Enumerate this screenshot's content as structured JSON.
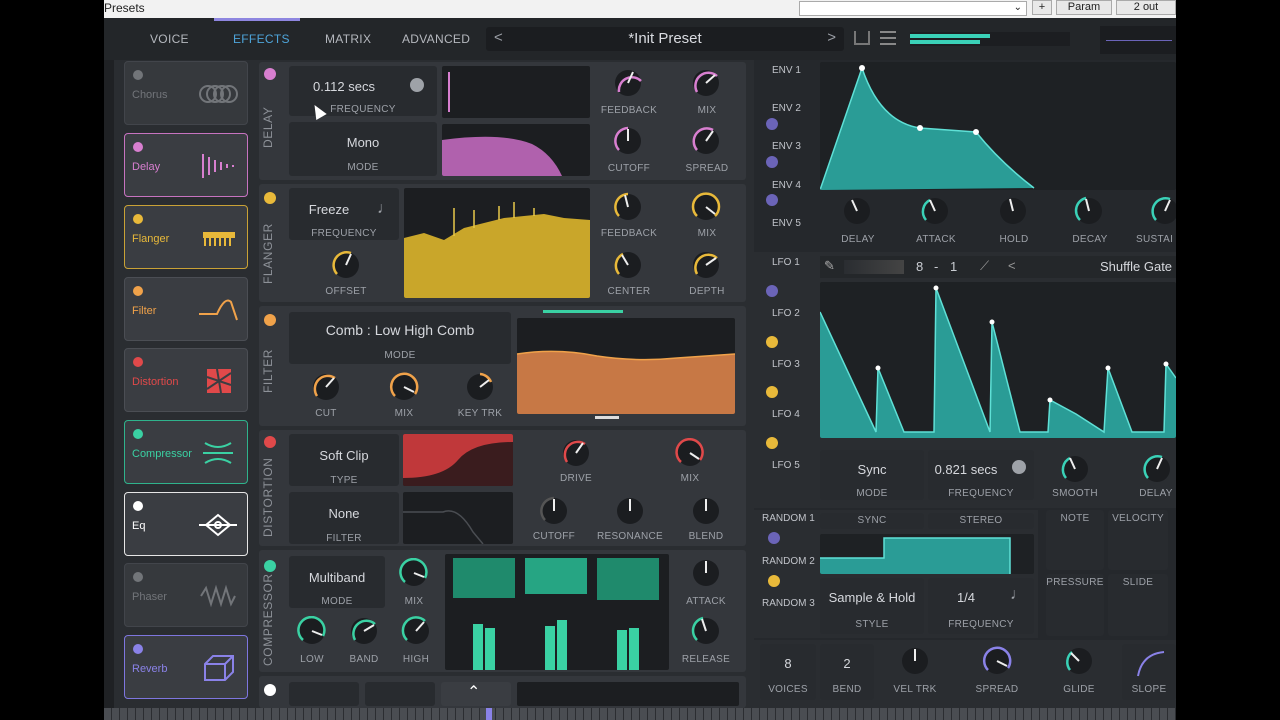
{
  "titlebar": {
    "title": "Presets",
    "param": "Param",
    "out": "2 out",
    "plus": "+"
  },
  "topbar": {
    "tabs": [
      "VOICE",
      "EFFECTS",
      "MATRIX",
      "ADVANCED"
    ],
    "preset": "*Init Preset",
    "prev": "<",
    "next": ">"
  },
  "effects_list": [
    {
      "name": "Chorus",
      "color": "#8a8d92",
      "enabled": false
    },
    {
      "name": "Delay",
      "color": "#d87fd0",
      "enabled": true
    },
    {
      "name": "Flanger",
      "color": "#e8b93a",
      "enabled": true
    },
    {
      "name": "Filter",
      "color": "#f0a24a",
      "enabled": true
    },
    {
      "name": "Distortion",
      "color": "#e0494a",
      "enabled": true
    },
    {
      "name": "Compressor",
      "color": "#3ad1a3",
      "enabled": true
    },
    {
      "name": "Eq",
      "color": "#ffffff",
      "enabled": true
    },
    {
      "name": "Phaser",
      "color": "#8a8d92",
      "enabled": false
    },
    {
      "name": "Reverb",
      "color": "#8a82e8",
      "enabled": true
    }
  ],
  "delay": {
    "title": "DELAY",
    "frequency_value": "0.112 secs",
    "frequency_label": "FREQUENCY",
    "mode_value": "Mono",
    "mode_label": "MODE",
    "knobs": [
      "FEEDBACK",
      "MIX",
      "CUTOFF",
      "SPREAD"
    ]
  },
  "flanger": {
    "title": "FLANGER",
    "frequency_value": "Freeze",
    "frequency_label": "FREQUENCY",
    "offset_label": "OFFSET",
    "knobs": [
      "FEEDBACK",
      "MIX",
      "CENTER",
      "DEPTH"
    ]
  },
  "filter": {
    "title": "FILTER",
    "mode_value": "Comb  :  Low High Comb",
    "mode_label": "MODE",
    "knobs": [
      "CUT",
      "MIX",
      "KEY TRK"
    ]
  },
  "distortion": {
    "title": "DISTORTION",
    "type_value": "Soft Clip",
    "type_label": "TYPE",
    "filter_value": "None",
    "filter_label": "FILTER",
    "knobs": [
      "DRIVE",
      "MIX",
      "CUTOFF",
      "RESONANCE",
      "BLEND"
    ]
  },
  "compressor": {
    "title": "COMPRESSOR",
    "mode_value": "Multiband",
    "mode_label": "MODE",
    "mix_label": "MIX",
    "knobs": [
      "LOW",
      "BAND",
      "HIGH"
    ],
    "attack_label": "ATTACK",
    "release_label": "RELEASE"
  },
  "env": {
    "tabs": [
      "ENV 1",
      "ENV 2",
      "ENV 3",
      "ENV 4",
      "ENV 5"
    ],
    "knobs": [
      "DELAY",
      "ATTACK",
      "HOLD",
      "DECAY",
      "SUSTAI"
    ]
  },
  "lfo": {
    "tabs": [
      "LFO 1",
      "LFO 2",
      "LFO 3",
      "LFO 4",
      "LFO 5"
    ],
    "grid_x": "8",
    "grid_sep": "-",
    "grid_y": "1",
    "preset": "Shuffle Gate",
    "sync_value": "Sync",
    "sync_label": "MODE",
    "freq_value": "0.821 secs",
    "freq_label": "FREQUENCY",
    "smooth_label": "SMOOTH",
    "delay_label": "DELAY"
  },
  "random": {
    "tabs": [
      "RANDOM 1",
      "RANDOM 2",
      "RANDOM 3"
    ],
    "sync": "SYNC",
    "stereo": "STEREO",
    "style_value": "Sample & Hold",
    "style_label": "STYLE",
    "freq_value": "1/4",
    "freq_label": "FREQUENCY"
  },
  "mod_sources": {
    "note": "NOTE",
    "velocity": "VELOCITY",
    "pressure": "PRESSURE",
    "slide": "SLIDE"
  },
  "voice": {
    "voices_value": "8",
    "voices_label": "VOICES",
    "bend_value": "2",
    "bend_label": "BEND",
    "veltrk_label": "VEL TRK",
    "spread_label": "SPREAD",
    "glide_label": "GLIDE",
    "slope_label": "SLOPE"
  }
}
